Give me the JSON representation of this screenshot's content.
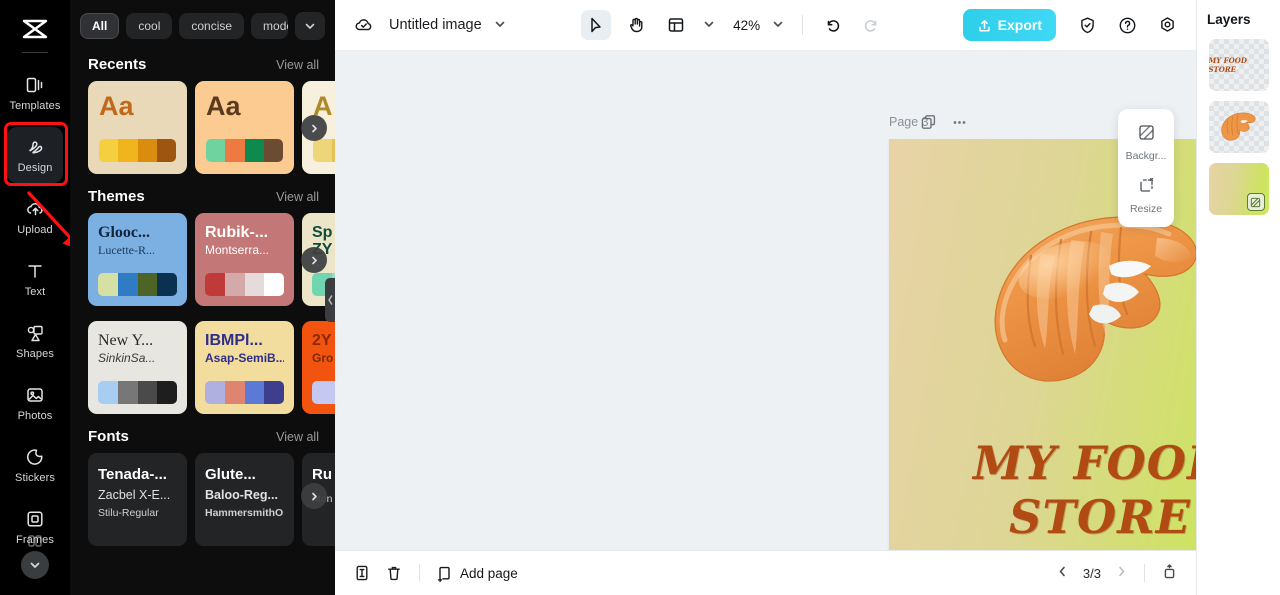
{
  "app": {
    "logo_icon": "capcut-logo-icon"
  },
  "rail": {
    "items": [
      {
        "label": "Templates",
        "icon": "templates-icon",
        "active": false
      },
      {
        "label": "Design",
        "icon": "design-icon",
        "active": true
      },
      {
        "label": "Upload",
        "icon": "upload-cloud-icon",
        "active": false
      },
      {
        "label": "Text",
        "icon": "text-icon",
        "active": false
      },
      {
        "label": "Shapes",
        "icon": "shapes-icon",
        "active": false
      },
      {
        "label": "Photos",
        "icon": "photos-icon",
        "active": false
      },
      {
        "label": "Stickers",
        "icon": "stickers-icon",
        "active": false
      },
      {
        "label": "Frames",
        "icon": "frames-icon",
        "active": false
      }
    ],
    "more_icon": "chevron-down-icon",
    "highlight_color": "#ff1111",
    "annotation_arrow_color": "#ff1111"
  },
  "panel": {
    "filters": [
      {
        "label": "All",
        "active": true
      },
      {
        "label": "cool",
        "active": false
      },
      {
        "label": "concise",
        "active": false
      },
      {
        "label": "modern",
        "active": false
      }
    ],
    "filter_more_icon": "chevron-down-icon",
    "view_all_label": "View all",
    "next_icon": "chevron-right-icon",
    "collapse_icon": "chevron-left-icon",
    "sections": [
      {
        "title": "Recents",
        "cards": [
          {
            "sample": "Aa",
            "bg": "#ead9b8",
            "fg": "#c0691b",
            "swatches": [
              "#f6cf3f",
              "#f0b41d",
              "#d98c0d",
              "#9e5510"
            ]
          },
          {
            "sample": "Aa",
            "bg": "#fbcb92",
            "fg": "#5a3b20",
            "swatches": [
              "#6fd3a0",
              "#ef7943",
              "#0f8a4e",
              "#6b4b32"
            ]
          },
          {
            "sample": "A",
            "bg": "#f7f0dd",
            "fg": "#b08a28",
            "swatches": [
              "#efd57a",
              "#e3c258",
              "#d9b63f",
              "#c9a32c"
            ]
          }
        ]
      },
      {
        "title": "Themes",
        "cards": [
          {
            "t1": "Glooc...",
            "t2": "Lucette-R...",
            "bg": "#7cb0e3",
            "fg1": "#11263d",
            "fg2": "#1b3a57",
            "swatches": [
              "#d6dfa4",
              "#2f7cc4",
              "#4c6426",
              "#0a3150"
            ]
          },
          {
            "t1": "Rubik-...",
            "t2": "Montserra...",
            "bg": "#c37777",
            "fg1": "#ffffff",
            "fg2": "#ffffff",
            "swatches": [
              "#c03a3a",
              "#d3a9a9",
              "#e7dada",
              "#ffffff"
            ]
          },
          {
            "t1": "Sp",
            "t2": "ZY",
            "bg": "#ece5c8",
            "fg1": "#0e4c3a",
            "fg2": "#0e4c3a",
            "swatches": [
              "#6fd6b0",
              "#9fd9c5",
              "#cfe6de",
              "#eef4f1"
            ]
          },
          {
            "t1": "New Y...",
            "t2": "SinkinSa...",
            "bg": "#e8e6e1",
            "fg1": "#2a2a2a",
            "fg2": "#3a3a3a",
            "swatches": [
              "#a7cef2",
              "#777777",
              "#4a4a4a",
              "#1e1e1e"
            ]
          },
          {
            "t1": "IBMPl...",
            "t2": "Asap-SemiB...",
            "bg": "#f2dc9e",
            "fg1": "#2f2f8a",
            "fg2": "#2f2f8a",
            "swatches": [
              "#b0b0e0",
              "#e08472",
              "#5b7ad6",
              "#3e3e8f"
            ]
          },
          {
            "t1": "2Y",
            "t2": "Gro",
            "bg": "#f2530e",
            "fg1": "#8a2a05",
            "fg2": "#7a2a05",
            "swatches": [
              "#c5c8f0",
              "#c5c8f0",
              "#c5c8f0",
              "#c5c8f0"
            ]
          }
        ]
      },
      {
        "title": "Fonts",
        "cards": [
          {
            "l1": "Tenada-...",
            "l2": "Zacbel X-E...",
            "l3": "Stilu-Regular"
          },
          {
            "l1": "Glute...",
            "l2": "Baloo-Reg...",
            "l3": "HammersmithOn..."
          },
          {
            "l1": "Ru",
            "l2": "",
            "l3": "Mon"
          }
        ]
      }
    ]
  },
  "topbar": {
    "cloud_icon": "cloud-check-icon",
    "doc_title": "Untitled image",
    "title_chevron_icon": "chevron-down-icon",
    "select_tool_icon": "cursor-select-icon",
    "hand_tool_icon": "hand-pan-icon",
    "layout_tool_icon": "layout-grid-icon",
    "layout_chevron_icon": "chevron-down-icon",
    "zoom_level": "42%",
    "zoom_chevron_icon": "chevron-down-icon",
    "undo_icon": "undo-icon",
    "redo_icon": "redo-icon",
    "export_label": "Export",
    "export_icon": "export-upload-icon",
    "export_color": "#33d3ef",
    "shield_icon": "shield-check-icon",
    "help_icon": "question-circle-icon",
    "settings_icon": "settings-gear-icon"
  },
  "canvas": {
    "page_label": "Page 3",
    "duplicate_page_icon": "duplicate-page-icon",
    "more_options_icon": "more-horizontal-icon",
    "artboard": {
      "title_text": "MY FOOD STORE",
      "title_color": "#b14b14",
      "gradient_start": "#e8d3a7",
      "gradient_end": "#cdea5e",
      "image_name": "croissant-3d-image"
    },
    "float_tools": [
      {
        "label": "Backgr...",
        "icon": "background-icon"
      },
      {
        "label": "Resize",
        "icon": "resize-icon"
      }
    ]
  },
  "bottombar": {
    "duplicate_icon": "duplicate-icon",
    "delete_icon": "trash-icon",
    "add_page_icon": "add-page-icon",
    "add_page_label": "Add page",
    "prev_icon": "chevron-left-icon",
    "page_indicator": "3/3",
    "next_icon": "chevron-right-icon",
    "collapse_pages_icon": "collapse-panel-icon"
  },
  "layers": {
    "title": "Layers",
    "items": [
      {
        "name": "text-layer",
        "text": "MY FOOD STORE",
        "type": "text"
      },
      {
        "name": "image-layer",
        "text": "",
        "type": "image"
      },
      {
        "name": "background-layer",
        "text": "",
        "type": "background",
        "badge_icon": "background-icon"
      }
    ]
  }
}
